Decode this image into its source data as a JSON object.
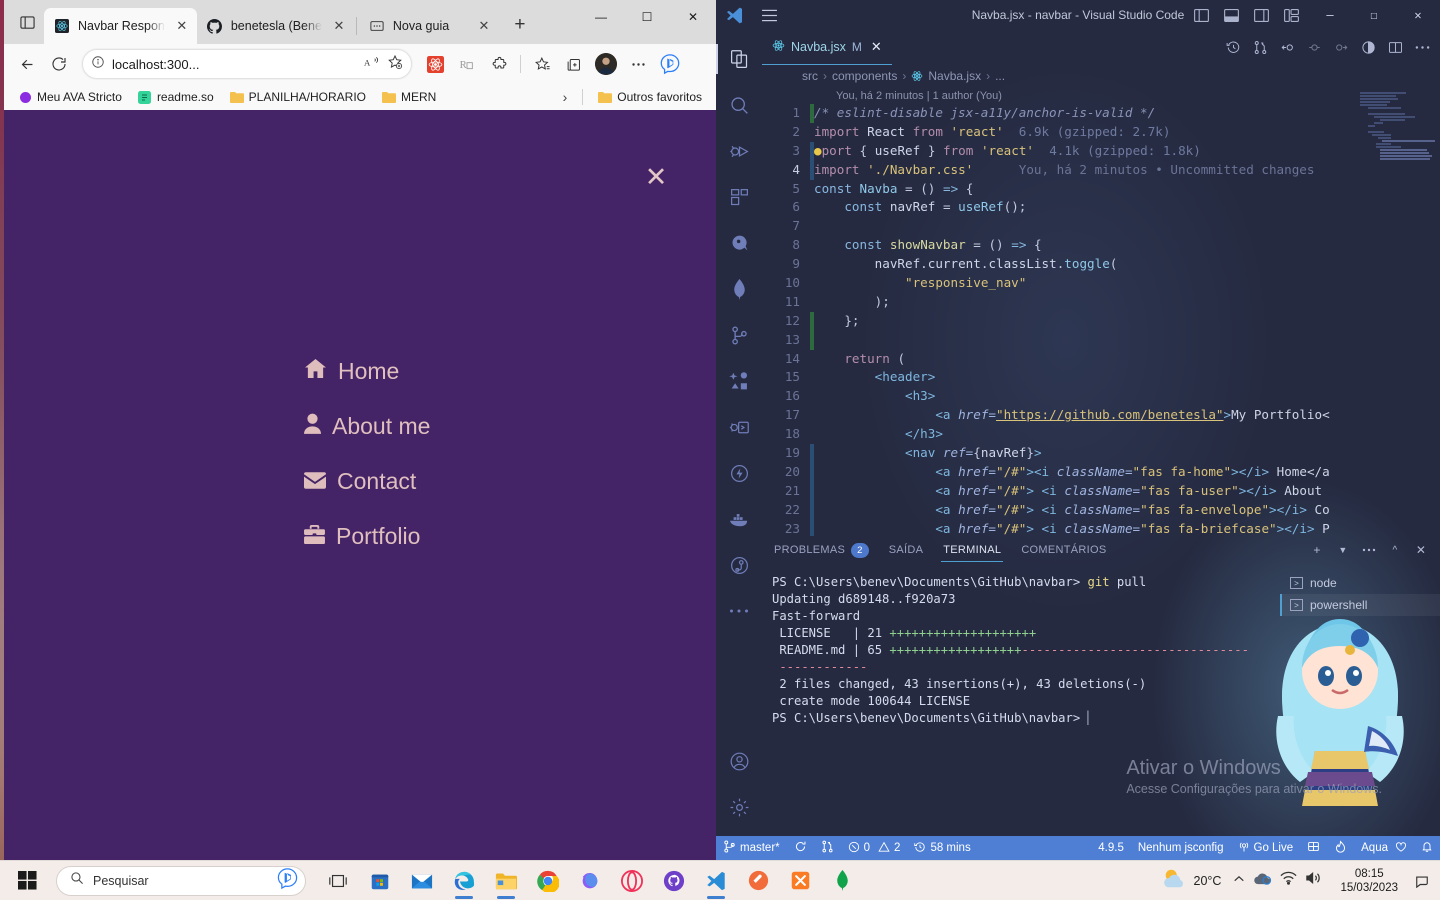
{
  "browser": {
    "tabs": [
      {
        "title": "Navbar Respon",
        "favicon": "react-icon",
        "active": true
      },
      {
        "title": "benetesla (Bene",
        "favicon": "github-icon",
        "active": false
      },
      {
        "title": "Nova guia",
        "favicon": "newtab-icon",
        "active": false
      }
    ],
    "new_tab_label": "+",
    "window_controls": {
      "minimize": "—",
      "maximize": "☐",
      "close": "✕"
    },
    "toolbar": {
      "back": "back-arrow",
      "refresh": "refresh-arrow",
      "url": "localhost:300...",
      "read_aloud": "A",
      "favorite": "star-plus"
    },
    "bookmarks": [
      {
        "label": "Meu AVA Stricto",
        "icon": "circle-purple"
      },
      {
        "label": "readme.so",
        "icon": "readme-icon"
      },
      {
        "label": "PLANILHA/HORARIO",
        "icon": "folder-icon"
      },
      {
        "label": "MERN",
        "icon": "folder-icon"
      },
      {
        "label": "Outros favoritos",
        "icon": "folder-icon"
      }
    ],
    "bookmarks_overflow": "›",
    "page": {
      "close_label": "✕",
      "background_color": "#442366",
      "link_color": "#e0bfbf",
      "nav_links": [
        {
          "label": "Home",
          "icon": "home-icon"
        },
        {
          "label": "About me",
          "icon": "user-icon"
        },
        {
          "label": "Contact",
          "icon": "envelope-icon"
        },
        {
          "label": "Portfolio",
          "icon": "briefcase-icon"
        }
      ]
    }
  },
  "vscode": {
    "window_title": "Navba.jsx - navbar - Visual Studio Code",
    "window_controls": {
      "minimize": "—",
      "maximize": "☐",
      "close": "✕"
    },
    "tab": {
      "filename": "Navba.jsx",
      "modified_badge": "M",
      "close": "✕"
    },
    "breadcrumb": [
      "src",
      "components",
      "Navba.jsx",
      "..."
    ],
    "breadcrumb_sep": "›",
    "blame": "You, há 2 minutos | 1 author (You)",
    "activity_icons": [
      "explorer-icon",
      "search-icon",
      "run-debug-icon",
      "extensions-icon",
      "quokka-icon",
      "mongodb-icon",
      "source-control-icon",
      "testing-icon",
      "remote-explorer-icon",
      "thunder-client-icon",
      "docker-icon",
      "gitlens-icon",
      "more-icon",
      "account-icon",
      "settings-icon"
    ],
    "code_lines": [
      {
        "n": 1,
        "html": "<span class='t-cmt'>/* eslint-disable jsx-a11y/anchor-is-valid */</span>"
      },
      {
        "n": 2,
        "html": "<span class='t-kw'>import</span> <span class='t-var'>React</span> <span class='t-kw'>from</span> <span class='t-str'>'react'</span>  <span class='inlay'>6.9k (gzipped: 2.7k)</span>"
      },
      {
        "n": 3,
        "html": "<span class='bulb'>●</span><span class='t-kw'>port</span> <span class='t-punct'>{</span> <span class='t-var'>useRef</span> <span class='t-punct'>}</span> <span class='t-kw'>from</span> <span class='t-str'>'react'</span>  <span class='inlay'>4.1k (gzipped: 1.8k)</span>"
      },
      {
        "n": 4,
        "html": "<span class='t-kw'>import</span> <span class='t-str'>'./Navbar.css'</span>      <span class='gitlens'>You, há 2 minutos • Uncommitted changes</span>"
      },
      {
        "n": 5,
        "html": "<span class='t-kw2'>const</span> <span class='t-def'>Navba</span> <span class='t-punct'>=</span> <span class='t-punct'>()</span> <span class='t-kw2'>=&gt;</span> <span class='t-punct'>{</span>"
      },
      {
        "n": 6,
        "html": "    <span class='t-kw2'>const</span> <span class='t-var'>navRef</span> <span class='t-punct'>=</span> <span class='t-def'>useRef</span><span class='t-punct'>();</span>"
      },
      {
        "n": 7,
        "html": ""
      },
      {
        "n": 8,
        "html": "    <span class='t-kw2'>const</span> <span class='t-fn'>showNavbar</span> <span class='t-punct'>=</span> <span class='t-punct'>()</span> <span class='t-kw2'>=&gt;</span> <span class='t-punct'>{</span>"
      },
      {
        "n": 9,
        "html": "        <span class='t-var'>navRef</span><span class='t-punct'>.</span><span class='t-var'>current</span><span class='t-punct'>.</span><span class='t-var'>classList</span><span class='t-punct'>.</span><span class='t-def'>toggle</span><span class='t-punct'>(</span>"
      },
      {
        "n": 10,
        "html": "            <span class='t-str'>\"responsive_nav\"</span>"
      },
      {
        "n": 11,
        "html": "        <span class='t-punct'>);</span>"
      },
      {
        "n": 12,
        "html": "    <span class='t-punct'>};</span>"
      },
      {
        "n": 13,
        "html": ""
      },
      {
        "n": 14,
        "html": "    <span class='t-kw'>return</span> <span class='t-punct'>(</span>"
      },
      {
        "n": 15,
        "html": "        <span class='t-tag'>&lt;header&gt;</span>"
      },
      {
        "n": 16,
        "html": "            <span class='t-tag'>&lt;h3&gt;</span>"
      },
      {
        "n": 17,
        "html": "                <span class='t-tag'>&lt;a</span> <span class='t-attr'>href=</span><span class='t-link'>\"https://github.com/benetesla\"</span><span class='t-tag'>&gt;</span>My Portfolio&lt;"
      },
      {
        "n": 18,
        "html": "            <span class='t-tag'>&lt;/h3&gt;</span>"
      },
      {
        "n": 19,
        "html": "            <span class='t-tag'>&lt;nav</span> <span class='t-attr'>ref=</span><span class='t-punct'>{</span><span class='t-var'>navRef</span><span class='t-punct'>}</span><span class='t-tag'>&gt;</span>"
      },
      {
        "n": 20,
        "html": "                <span class='t-tag'>&lt;a</span> <span class='t-attr'>href=</span><span class='t-str'>\"/#\"</span><span class='t-tag'>&gt;&lt;i</span> <span class='t-attr'>className=</span><span class='t-str'>\"fas fa-home\"</span><span class='t-tag'>&gt;&lt;/i&gt;</span> Home&lt;/a"
      },
      {
        "n": 21,
        "html": "                <span class='t-tag'>&lt;a</span> <span class='t-attr'>href=</span><span class='t-str'>\"/#\"</span><span class='t-tag'>&gt;</span> <span class='t-tag'>&lt;i</span> <span class='t-attr'>className=</span><span class='t-str'>\"fas fa-user\"</span><span class='t-tag'>&gt;&lt;/i&gt;</span> About"
      },
      {
        "n": 22,
        "html": "                <span class='t-tag'>&lt;a</span> <span class='t-attr'>href=</span><span class='t-str'>\"/#\"</span><span class='t-tag'>&gt;</span> <span class='t-tag'>&lt;i</span> <span class='t-attr'>className=</span><span class='t-str'>\"fas fa-envelope\"</span><span class='t-tag'>&gt;&lt;/i&gt;</span> Co"
      },
      {
        "n": 23,
        "html": "                <span class='t-tag'>&lt;a</span> <span class='t-attr'>href=</span><span class='t-str'>\"/#\"</span><span class='t-tag'>&gt;</span> <span class='t-tag'>&lt;i</span> <span class='t-attr'>className=</span><span class='t-str'>\"fas fa-briefcase\"</span><span class='t-tag'>&gt;&lt;/i&gt;</span> P"
      }
    ],
    "panel": {
      "tabs": [
        {
          "label": "PROBLEMAS",
          "badge": "2",
          "active": false
        },
        {
          "label": "SAÍDA",
          "badge": "",
          "active": false
        },
        {
          "label": "TERMINAL",
          "badge": "",
          "active": true
        },
        {
          "label": "COMENTÁRIOS",
          "badge": "",
          "active": false
        }
      ],
      "actions": [
        "add-terminal-icon",
        "chevron-down-icon",
        "more-icon",
        "maximize-panel-icon",
        "close-panel-icon"
      ],
      "terminal_lines": [
        {
          "html": "PS C:\\Users\\benev\\Documents\\GitHub\\navbar&gt; <span class='c-yellow'>git</span> pull"
        },
        {
          "html": "Updating d689148..f920a73"
        },
        {
          "html": "Fast-forward"
        },
        {
          "html": " LICENSE   | 21 <span class='c-green'>++++++++++++++++++++</span>"
        },
        {
          "html": " README.md | 65 <span class='c-green'>++++++++++++++++++</span><span class='c-red'>-------------------------------</span>"
        },
        {
          "html": " <span class='c-red'>------------</span>"
        },
        {
          "html": " 2 files changed, 43 insertions(+), 43 deletions(-)"
        },
        {
          "html": " create mode 100644 LICENSE"
        },
        {
          "html": "PS C:\\Users\\benev\\Documents\\GitHub\\navbar&gt; <span style='opacity:.8'>▏</span>"
        }
      ],
      "sessions": [
        {
          "label": "node",
          "active": false
        },
        {
          "label": "powershell",
          "active": true
        }
      ]
    },
    "status_bar": {
      "branch": "master*",
      "sync_icon": "sync-icon",
      "branch_compare_icon": "git-compare-icon",
      "errors": "0",
      "warnings": "2",
      "timer": "58 mins",
      "version": "4.9.5",
      "jsconfig": "Nenhum jsconfig",
      "go_live": "Go Live",
      "prettier_icon": "prettier-icon",
      "flame_icon": "flame-icon",
      "theme": "Aqua",
      "heart_icon": "heart-icon",
      "bell_icon": "bell-icon"
    },
    "watermark": {
      "line1": "Ativar o Windows",
      "line2": "Acesse Configurações para ativar o Windows."
    }
  },
  "taskbar": {
    "start": "windows-logo-icon",
    "search_placeholder": "Pesquisar",
    "bing_icon": "bing-chat-icon",
    "icons": [
      {
        "name": "task-view-icon",
        "running": false
      },
      {
        "name": "microsoft-store-icon",
        "running": false
      },
      {
        "name": "mail-icon",
        "running": false
      },
      {
        "name": "edge-icon",
        "running": true
      },
      {
        "name": "file-explorer-icon",
        "running": true
      },
      {
        "name": "chrome-icon",
        "running": false
      },
      {
        "name": "edge-dev-icon",
        "running": false
      },
      {
        "name": "opera-icon",
        "running": false
      },
      {
        "name": "github-desktop-icon",
        "running": false
      },
      {
        "name": "vscode-icon",
        "running": true
      },
      {
        "name": "postman-icon",
        "running": false
      },
      {
        "name": "xampp-icon",
        "running": false
      },
      {
        "name": "mongodb-compass-icon",
        "running": false
      }
    ],
    "weather": {
      "temp": "20°C",
      "icon": "sun-cloud-icon"
    },
    "tray": [
      "chevron-up-icon",
      "onedrive-icon",
      "wifi-icon",
      "volume-icon"
    ],
    "clock": {
      "time": "08:15",
      "date": "15/03/2023"
    },
    "notification_icon": "notification-icon"
  }
}
